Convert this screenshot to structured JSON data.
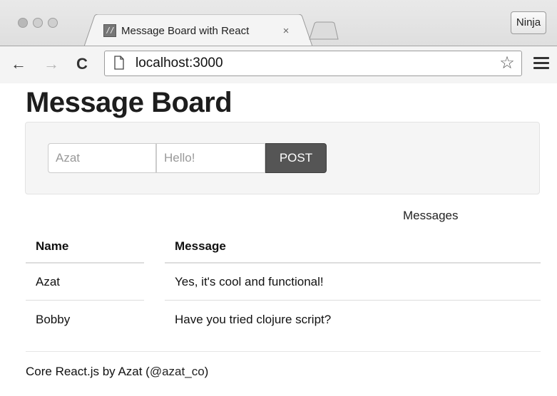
{
  "browser": {
    "tab_title": "Message Board with React",
    "tab_close": "×",
    "profile_label": "Ninja",
    "url": "localhost:3000",
    "back_glyph": "←",
    "forward_glyph": "→",
    "reload_glyph": "C",
    "star_glyph": "☆",
    "favicon_text": "//"
  },
  "page": {
    "title": "Message Board",
    "form": {
      "name_value": "Azat",
      "message_value": "Hello!",
      "post_label": "POST"
    },
    "table": {
      "caption": "Messages",
      "headers": [
        "Name",
        "Message"
      ],
      "rows": [
        {
          "name": "Azat",
          "message": "Yes, it's cool and functional!"
        },
        {
          "name": "Bobby",
          "message": "Have you tried clojure script?"
        }
      ]
    },
    "footer": {
      "prefix": "Core React.js by Azat (",
      "link": "@azat_co",
      "suffix": ")"
    }
  }
}
